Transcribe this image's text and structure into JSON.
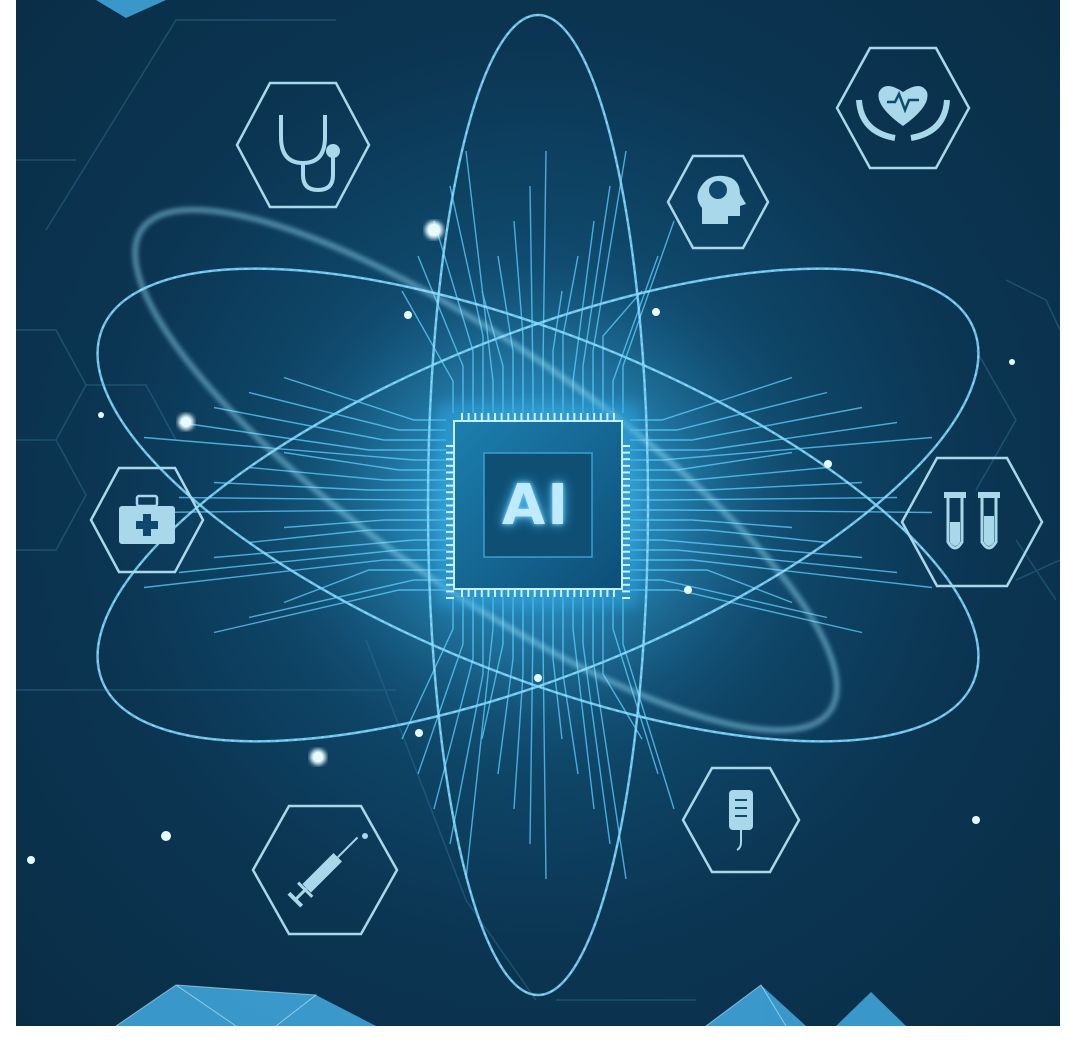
{
  "chip": {
    "label": "AI"
  },
  "icons": [
    {
      "name": "stethoscope-icon"
    },
    {
      "name": "brain-head-icon"
    },
    {
      "name": "heart-hands-icon"
    },
    {
      "name": "first-aid-kit-icon"
    },
    {
      "name": "test-tubes-icon"
    },
    {
      "name": "syringe-icon"
    },
    {
      "name": "iv-bag-icon"
    }
  ],
  "colors": {
    "background": "#0b3552",
    "glow": "#4fc3ff",
    "line": "#5fd0ff",
    "hexagon_stroke": "#a9d8ea"
  }
}
